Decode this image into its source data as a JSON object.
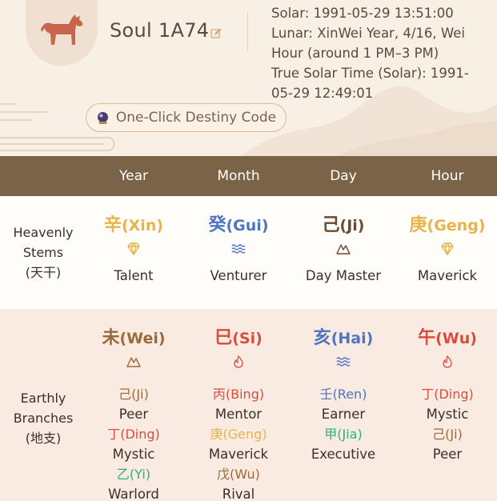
{
  "profile": {
    "name": "Soul 1A74",
    "avatar_icon": "goat-icon",
    "edit_icon": "edit-icon"
  },
  "birth": {
    "solar": "Solar: 1991-05-29 13:51:00",
    "lunar": "Lunar: XinWei Year, 4/16, Wei Hour (around 1 PM–3 PM)",
    "true_solar": "True Solar Time (Solar): 1991-05-29 12:49:01"
  },
  "destiny_button": {
    "label": "One-Click Destiny Code",
    "icon": "crystal-ball-icon"
  },
  "columns": [
    "Year",
    "Month",
    "Day",
    "Hour"
  ],
  "stems_row": {
    "label_line1": "Heavenly",
    "label_line2": "Stems",
    "label_line3": "(天干)",
    "cells": [
      {
        "han": "辛",
        "pinyin": "(Xin)",
        "element": "metal",
        "icon": "diamond-icon",
        "role": "Talent"
      },
      {
        "han": "癸",
        "pinyin": "(Gui)",
        "element": "water",
        "icon": "waves-icon",
        "role": "Venturer"
      },
      {
        "han": "己",
        "pinyin": "(Ji)",
        "element": "earth",
        "icon": "mountain-icon",
        "role": "Day Master"
      },
      {
        "han": "庚",
        "pinyin": "(Geng)",
        "element": "metal",
        "icon": "diamond-icon",
        "role": "Maverick"
      }
    ]
  },
  "branches_row": {
    "label_line1": "Earthly",
    "label_line2": "Branches",
    "label_line3": "(地支)",
    "cells": [
      {
        "han": "未",
        "pinyin": "(Wei)",
        "element": "earth",
        "icon": "mountain-icon",
        "hidden": [
          {
            "stem": "己(Ji)",
            "element": "earth",
            "god": "Peer"
          },
          {
            "stem": "丁(Ding)",
            "element": "fire",
            "god": "Mystic"
          },
          {
            "stem": "乙(Yi)",
            "element": "wood",
            "god": "Warlord"
          }
        ]
      },
      {
        "han": "巳",
        "pinyin": "(Si)",
        "element": "fire",
        "icon": "flame-icon",
        "hidden": [
          {
            "stem": "丙(Bing)",
            "element": "fire",
            "god": "Mentor"
          },
          {
            "stem": "庚(Geng)",
            "element": "metal",
            "god": "Maverick"
          },
          {
            "stem": "戊(Wu)",
            "element": "earth",
            "god": "Rival"
          }
        ]
      },
      {
        "han": "亥",
        "pinyin": "(Hai)",
        "element": "water",
        "icon": "waves-icon",
        "hidden": [
          {
            "stem": "壬(Ren)",
            "element": "water",
            "god": "Earner"
          },
          {
            "stem": "甲(Jia)",
            "element": "wood",
            "god": "Executive"
          }
        ]
      },
      {
        "han": "午",
        "pinyin": "(Wu)",
        "element": "fire",
        "icon": "flame-icon",
        "hidden": [
          {
            "stem": "丁(Ding)",
            "element": "fire",
            "god": "Mystic"
          },
          {
            "stem": "己(Ji)",
            "element": "earth",
            "god": "Peer"
          }
        ]
      }
    ]
  },
  "colors": {
    "metal": "#e8b44a",
    "water": "#4f74c0",
    "earth": "#9b6a3a",
    "fire": "#dd4a3e",
    "wood": "#2fb07d",
    "header_bar": "#7a6346"
  }
}
